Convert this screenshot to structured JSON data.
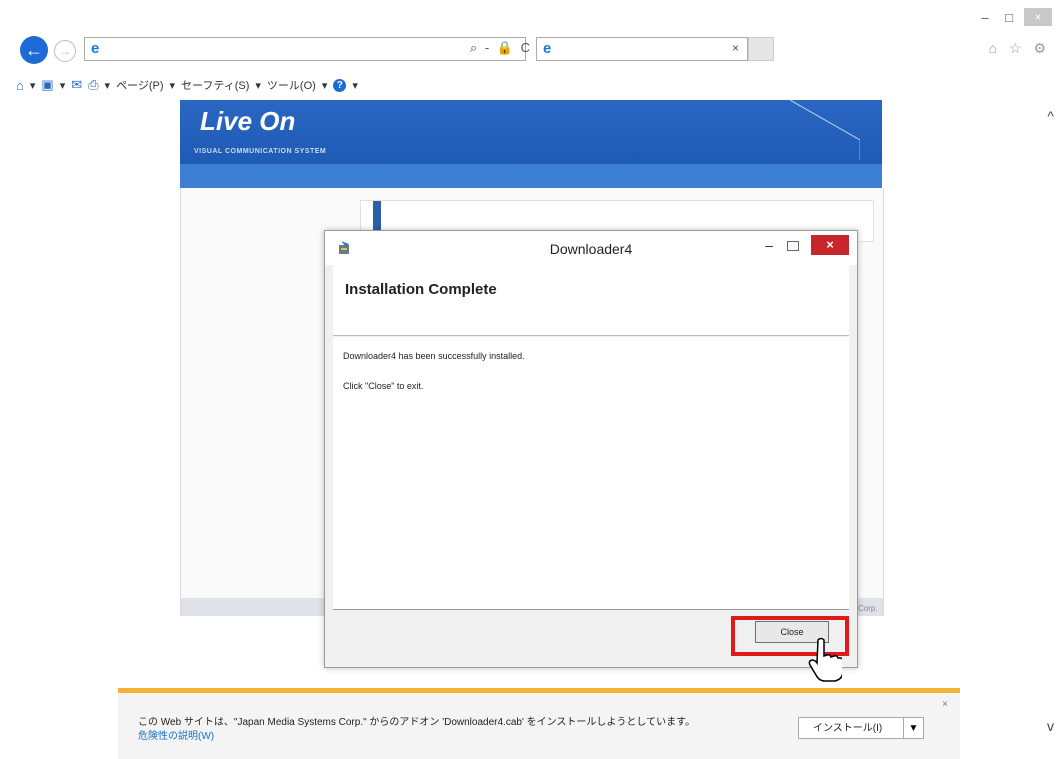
{
  "browser": {
    "window_controls": {
      "minimize": "–",
      "maximize": "□",
      "close": "×"
    },
    "back_icon": "←",
    "forward_icon": "→",
    "address_tools": "⌕ - 🔒 C",
    "tab_close": "×",
    "right_icons": "⌂ ☆ ⚙",
    "command_bar": {
      "page": "ページ(P)",
      "safety": "セーフティ(S)",
      "tools": "ツール(O)"
    },
    "scroll_up": "^",
    "scroll_down": "v"
  },
  "website": {
    "logo": "Live On",
    "tagline": "VISUAL COMMUNICATION SYSTEM",
    "corp_fragment": "Corp."
  },
  "dialog": {
    "title": "Downloader4",
    "heading": "Installation Complete",
    "line1": "Downloader4 has been successfully installed.",
    "line2": "Click \"Close\" to exit.",
    "close_button": "Close"
  },
  "notification": {
    "message": "この Web サイトは、\"Japan Media Systems Corp.\" からのアドオン 'Downloader4.cab' をインストールしようとしています。",
    "link": "危険性の説明(W)",
    "install_button": "インストール(I)",
    "dropdown": "▼",
    "close": "×"
  },
  "colors": {
    "accent_blue": "#1e6ad6",
    "banner_blue": "#1a56b0",
    "highlight_red": "#e01a1a",
    "notification_border": "#f2b233"
  }
}
